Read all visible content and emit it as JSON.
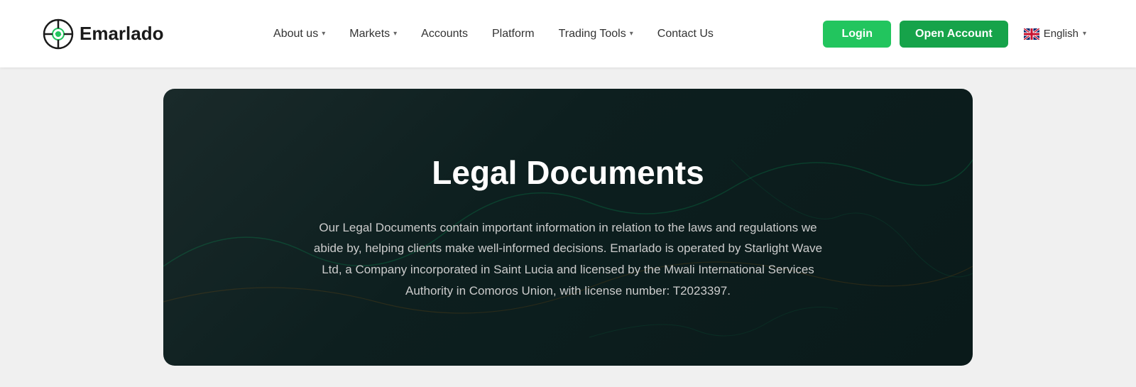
{
  "brand": {
    "name": "Emarlado",
    "logo_alt": "Emarlado logo"
  },
  "navbar": {
    "links": [
      {
        "id": "about-us",
        "label": "About us",
        "has_dropdown": true
      },
      {
        "id": "markets",
        "label": "Markets",
        "has_dropdown": true
      },
      {
        "id": "accounts",
        "label": "Accounts",
        "has_dropdown": false
      },
      {
        "id": "platform",
        "label": "Platform",
        "has_dropdown": false
      },
      {
        "id": "trading-tools",
        "label": "Trading Tools",
        "has_dropdown": true
      },
      {
        "id": "contact-us",
        "label": "Contact Us",
        "has_dropdown": false
      }
    ],
    "login_label": "Login",
    "open_account_label": "Open Account",
    "language": {
      "code": "EN",
      "label": "English"
    }
  },
  "hero": {
    "title": "Legal Documents",
    "description": "Our Legal Documents contain important information in relation to the laws and regulations we abide by, helping clients make well-informed decisions. Emarlado is operated by Starlight Wave Ltd, a Company incorporated in Saint Lucia and licensed by the Mwali International Services Authority in Comoros Union, with license number: T2023397."
  }
}
